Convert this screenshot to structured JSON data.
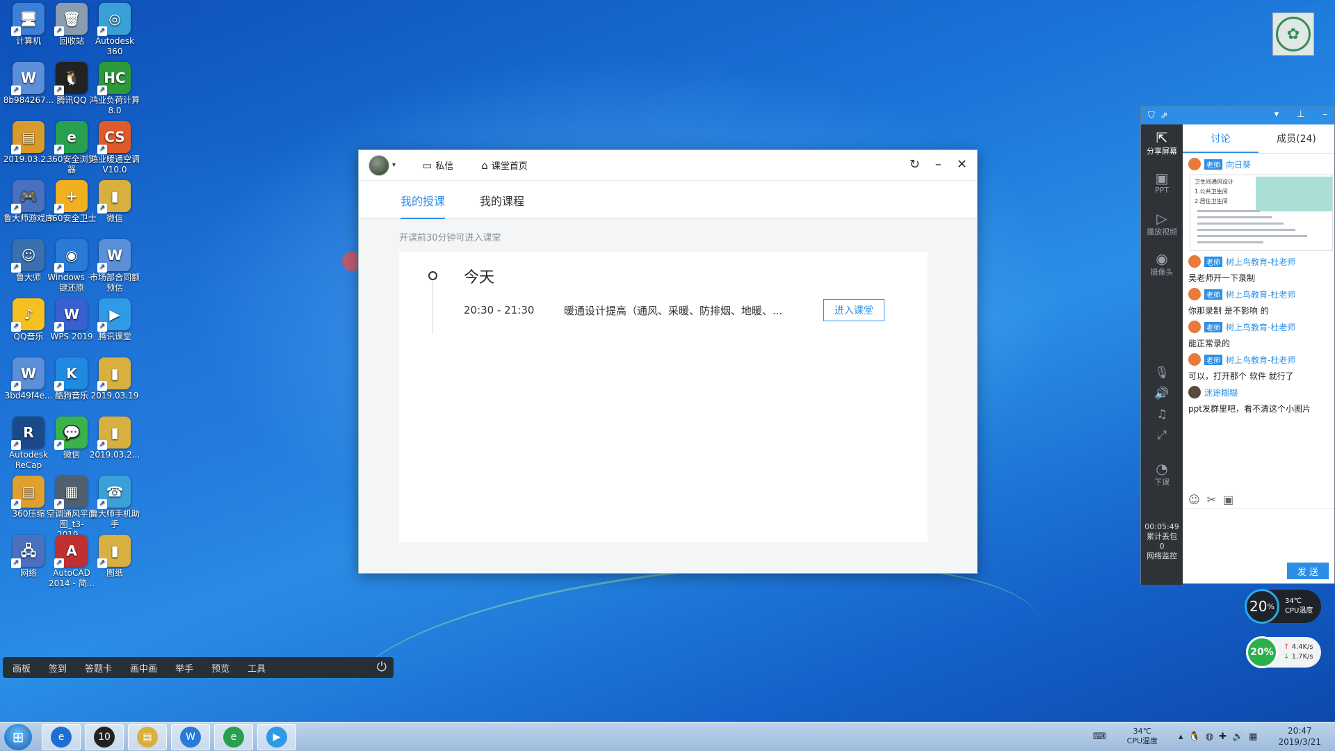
{
  "desktop": {
    "icons": [
      {
        "label": "计算机",
        "icon": "computer-icon",
        "glyph": "🖥"
      },
      {
        "label": "回收站",
        "icon": "recycle-bin-icon",
        "glyph": "🗑"
      },
      {
        "label": "Autodesk 360",
        "icon": "autodesk-360-icon",
        "glyph": "◎"
      },
      {
        "label": "8b984267...",
        "icon": "document-icon",
        "glyph": "W"
      },
      {
        "label": "腾讯QQ",
        "icon": "qq-icon",
        "glyph": "🐧"
      },
      {
        "label": "鸿业负荷计算8.0",
        "icon": "hc-load-icon",
        "glyph": "HC"
      },
      {
        "label": "2019.03.2...",
        "icon": "archive-icon",
        "glyph": "▤"
      },
      {
        "label": "360安全浏览器",
        "icon": "360-browser-icon",
        "glyph": "e"
      },
      {
        "label": "鸿业暖通空调V10.0",
        "icon": "hongye-hvac-icon",
        "glyph": "CS"
      },
      {
        "label": "鲁大师游戏库",
        "icon": "gamepad-icon",
        "glyph": "🎮"
      },
      {
        "label": "360安全卫士",
        "icon": "360-safe-icon",
        "glyph": "+"
      },
      {
        "label": "微信",
        "icon": "folder-icon",
        "glyph": "▮"
      },
      {
        "label": "鲁大师",
        "icon": "ludashi-icon",
        "glyph": "☺"
      },
      {
        "label": "Windows 一键还原",
        "icon": "windows-restore-icon",
        "glyph": "◉"
      },
      {
        "label": "市场部合同额预估",
        "icon": "document-icon",
        "glyph": "W"
      },
      {
        "label": "QQ音乐",
        "icon": "qq-music-icon",
        "glyph": "♪"
      },
      {
        "label": "WPS 2019",
        "icon": "wps-icon",
        "glyph": "W"
      },
      {
        "label": "腾讯课堂",
        "icon": "tencent-classroom-icon",
        "glyph": "▶"
      },
      {
        "label": "3bd49f4e...",
        "icon": "document-icon",
        "glyph": "W"
      },
      {
        "label": "酷狗音乐",
        "icon": "kugou-icon",
        "glyph": "K"
      },
      {
        "label": "2019.03.19",
        "icon": "folder-icon",
        "glyph": "▮"
      },
      {
        "label": "Autodesk ReCap",
        "icon": "autodesk-recap-icon",
        "glyph": "R"
      },
      {
        "label": "微信",
        "icon": "wechat-icon",
        "glyph": "💬"
      },
      {
        "label": "2019.03.2...",
        "icon": "folder-icon",
        "glyph": "▮"
      },
      {
        "label": "360压缩",
        "icon": "archive-icon",
        "glyph": "▤"
      },
      {
        "label": "空调通风平面图_t3-2019...",
        "icon": "image-file-icon",
        "glyph": "▦"
      },
      {
        "label": "鲁大师手机助手",
        "icon": "phone-assistant-icon",
        "glyph": "☎"
      },
      {
        "label": "网络",
        "icon": "network-icon",
        "glyph": "🖧"
      },
      {
        "label": "AutoCAD 2014 - 简...",
        "icon": "autocad-icon",
        "glyph": "A"
      },
      {
        "label": "图纸",
        "icon": "folder-icon",
        "glyph": "▮"
      }
    ]
  },
  "window": {
    "nav": {
      "message_label": "私信",
      "home_label": "课堂首页"
    },
    "tabs": [
      {
        "label": "我的授课",
        "active": true
      },
      {
        "label": "我的课程",
        "active": false
      }
    ],
    "hint": "开课前30分钟可进入课堂",
    "schedule": {
      "day": "今天",
      "time": "20:30 - 21:30",
      "title": "暖通设计提高（通风、采暖、防排烟、地暖、...",
      "enter_label": "进入课堂"
    }
  },
  "toolbar": {
    "items": [
      "画板",
      "签到",
      "答题卡",
      "画中画",
      "举手",
      "预览",
      "工具"
    ]
  },
  "panel": {
    "side": [
      {
        "label": "分享屏幕",
        "icon": "share-screen-icon",
        "glyph": "⇱",
        "on": true
      },
      {
        "label": "PPT",
        "icon": "ppt-icon",
        "glyph": "▣",
        "on": false
      },
      {
        "label": "播放视频",
        "icon": "play-video-icon",
        "glyph": "▷",
        "on": false
      },
      {
        "label": "摄像头",
        "icon": "camera-icon",
        "glyph": "◉",
        "on": false
      }
    ],
    "end_label": "下课",
    "timer": "00:05:49",
    "stat1": "累计丢包",
    "stat2": "0",
    "stat3": "网络监控",
    "tabs": [
      {
        "label": "讨论",
        "active": true
      },
      {
        "label": "成员(24)",
        "active": false
      }
    ],
    "teacher_tag": "老师",
    "messages": [
      {
        "name": "向日葵",
        "tag": true,
        "text": ""
      },
      {
        "name": "树上鸟教育-杜老师",
        "tag": true,
        "text": "吴老师开一下录制"
      },
      {
        "name": "树上鸟教育-杜老师",
        "tag": true,
        "text": "你那录制 是不影响 的"
      },
      {
        "name": "树上鸟教育-杜老师",
        "tag": true,
        "text": "能正常录的"
      },
      {
        "name": "树上鸟教育-杜老师",
        "tag": true,
        "text": "可以，打开那个 软件 就行了"
      },
      {
        "name": "迷途糊糊",
        "tag": false,
        "text": "ppt发群里吧，看不清这个小图片"
      }
    ],
    "thumb_lines": [
      "卫生间通风设计",
      "1.公共卫生间",
      "2.居住卫生间"
    ],
    "send_label": "发 送"
  },
  "monitor": {
    "cpu_usage": "20",
    "cpu_usage_unit": "%",
    "cpu_temp": "34℃",
    "cpu_temp_label": "CPU温度",
    "mem_usage": "20%",
    "up_speed": "4.4K/s",
    "down_speed": "1.7K/s"
  },
  "taskbar": {
    "apps": [
      {
        "icon": "ie-icon",
        "glyph": "e"
      },
      {
        "icon": "lol-icon",
        "glyph": "10"
      },
      {
        "icon": "explorer-icon",
        "glyph": "▤"
      },
      {
        "icon": "wps-icon",
        "glyph": "W"
      },
      {
        "icon": "360-browser-icon",
        "glyph": "e"
      },
      {
        "icon": "tencent-classroom-icon",
        "glyph": "▶"
      }
    ],
    "temp": "34℃",
    "temp_label": "CPU温度",
    "time": "20:47",
    "date": "2019/3/21"
  }
}
